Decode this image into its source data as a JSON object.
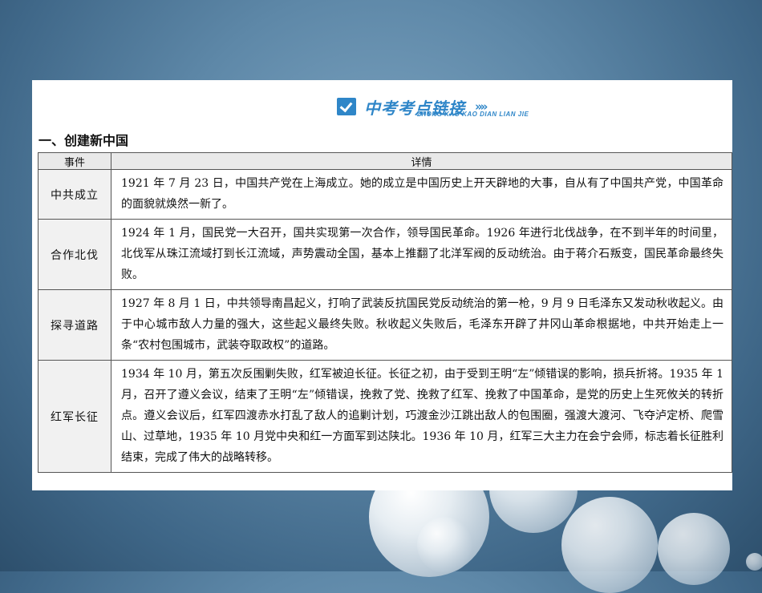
{
  "banner": {
    "title": "中考考点链接",
    "arrows": "»»",
    "subtitle": "ZHONG KAO KAO DIAN LIAN JIE"
  },
  "section_title": "一、创建新中国",
  "table": {
    "headers": [
      "事件",
      "详情"
    ],
    "rows": [
      {
        "event": "中共成立",
        "detail": "1921 年 7 月 23 日，中国共产党在上海成立。她的成立是中国历史上开天辟地的大事，自从有了中国共产党，中国革命的面貌就焕然一新了。"
      },
      {
        "event": "合作北伐",
        "detail": "1924 年 1 月，国民党一大召开，国共实现第一次合作，领导国民革命。1926 年进行北伐战争，在不到半年的时间里，北伐军从珠江流域打到长江流域，声势震动全国，基本上推翻了北洋军阀的反动统治。由于蒋介石叛变，国民革命最终失败。"
      },
      {
        "event": "探寻道路",
        "detail": "1927 年 8 月 1 日，中共领导南昌起义，打响了武装反抗国民党反动统治的第一枪，9 月 9 日毛泽东又发动秋收起义。由于中心城市敌人力量的强大，这些起义最终失败。秋收起义失败后，毛泽东开辟了井冈山革命根据地，中共开始走上一条“农村包围城市，武装夺取政权”的道路。"
      },
      {
        "event": "红军长征",
        "detail": "1934 年 10 月，第五次反围剿失败，红军被迫长征。长征之初，由于受到王明“左”倾错误的影响，损兵折将。1935 年 1 月，召开了遵义会议，结束了王明“左”倾错误，挽救了党、挽救了红军、挽救了中国革命，是党的历史上生死攸关的转折点。遵义会议后，红军四渡赤水打乱了敌人的追剿计划，巧渡金沙江跳出敌人的包围圈，强渡大渡河、飞夺泸定桥、爬雪山、过草地，1935 年 10 月党中央和红一方面军到达陕北。1936 年 10 月，红军三大主力在会宁会师，标志着长征胜利结束，完成了伟大的战略转移。"
      }
    ]
  }
}
